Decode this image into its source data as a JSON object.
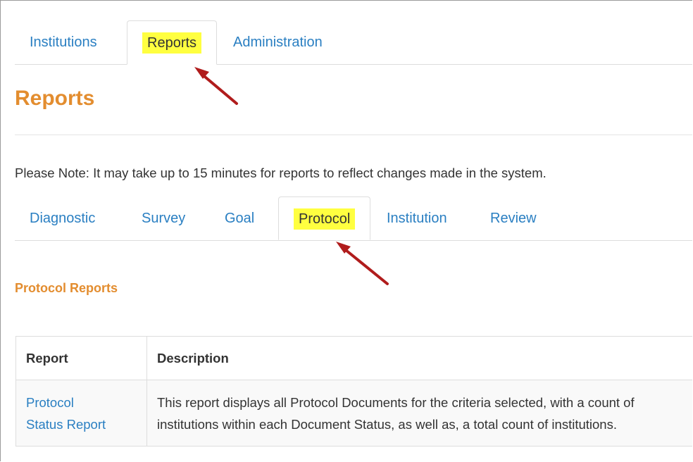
{
  "top_tabs": [
    {
      "label": "Institutions",
      "active": false
    },
    {
      "label": "Reports",
      "active": true
    },
    {
      "label": "Administration",
      "active": false
    }
  ],
  "page": {
    "title": "Reports",
    "note": "Please Note: It may take up to 15 minutes for reports to reflect changes made in the system."
  },
  "report_tabs": [
    {
      "label": "Diagnostic",
      "active": false
    },
    {
      "label": "Survey",
      "active": false
    },
    {
      "label": "Goal",
      "active": false
    },
    {
      "label": "Protocol",
      "active": true
    },
    {
      "label": "Institution",
      "active": false
    },
    {
      "label": "Review",
      "active": false
    }
  ],
  "section": {
    "title": "Protocol Reports"
  },
  "table": {
    "headers": [
      "Report",
      "Description"
    ],
    "rows": [
      {
        "report_line1": "Protocol",
        "report_line2": "Status Report",
        "desc_line1": "This report displays all Protocol Documents for the criteria selected, with a count of",
        "desc_line2": "institutions within each Document Status, as well as, a total count of institutions."
      }
    ]
  },
  "colors": {
    "link": "#2a7fc2",
    "heading": "#e38d2f",
    "highlight": "#ffff40",
    "arrow": "#b01c1c"
  },
  "annotations": [
    "arrow-icon",
    "arrow-icon"
  ]
}
